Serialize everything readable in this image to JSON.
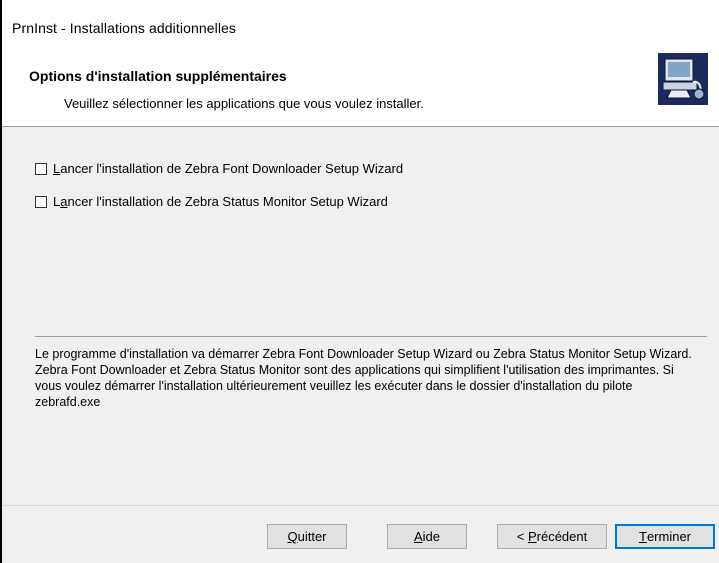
{
  "window": {
    "title": "PrnInst - Installations additionnelles"
  },
  "header": {
    "title": "Options d'installation supplémentaires",
    "subtitle": "Veuillez sélectionner les applications que vous voulez installer.",
    "icon": "printer-install-icon"
  },
  "options": [
    {
      "label_accel": "L",
      "label_rest": "ancer l'installation de Zebra Font Downloader Setup Wizard",
      "checked": false
    },
    {
      "label_pre": "L",
      "label_accel": "a",
      "label_rest": "ncer l'installation de Zebra Status Monitor Setup Wizard",
      "checked": false
    }
  ],
  "info": {
    "text": "Le programme d'installation va démarrer Zebra Font Downloader Setup Wizard ou Zebra Status Monitor Setup Wizard. Zebra Font Downloader et Zebra Status Monitor sont des applications qui simplifient l'utilisation des imprimantes. Si vous voulez démarrer l'installation ultérieurement veuillez les exécuter dans le dossier d'installation du pilote zebrafd.exe"
  },
  "buttons": {
    "quit": {
      "accel": "Q",
      "rest": "uitter"
    },
    "help": {
      "accel": "A",
      "rest": "ide"
    },
    "back": {
      "pre": "< ",
      "accel": "P",
      "rest": "récédent"
    },
    "finish": {
      "accel": "T",
      "rest": "erminer"
    }
  },
  "colors": {
    "default_button_border": "#0078d7",
    "dialog_bg": "#f0f0f0"
  }
}
